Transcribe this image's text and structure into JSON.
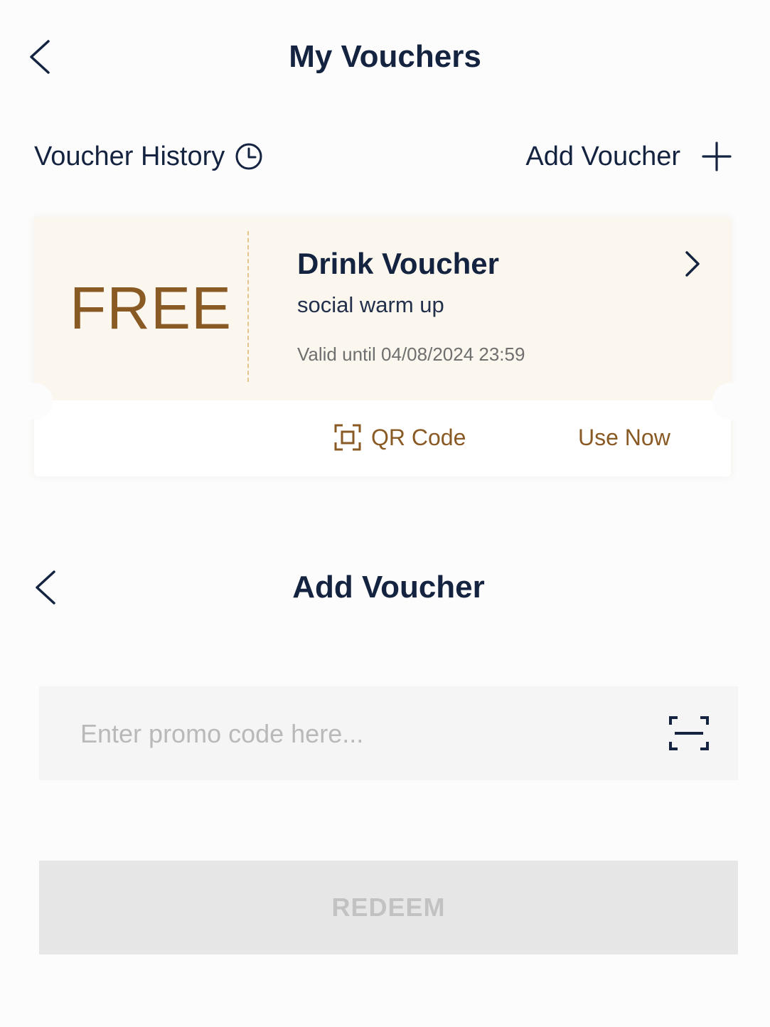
{
  "header": {
    "title": "My Vouchers",
    "back_icon": "chevron-left-icon"
  },
  "actions": {
    "history_label": "Voucher History",
    "history_icon": "clock-icon",
    "add_label": "Add Voucher",
    "add_icon": "plus-icon"
  },
  "voucher": {
    "badge": "FREE",
    "title": "Drink Voucher",
    "subtitle": "social warm up",
    "valid_until": "Valid until 04/08/2024 23:59",
    "qr_label": "QR Code",
    "qr_icon": "qr-scan-icon",
    "use_label": "Use Now",
    "detail_icon": "chevron-right-icon"
  },
  "add_voucher": {
    "title": "Add Voucher",
    "input_placeholder": "Enter promo code here...",
    "input_value": "",
    "scan_icon": "barcode-scan-icon",
    "redeem_label": "REDEEM"
  },
  "colors": {
    "navy": "#14233f",
    "gold": "#8a5a25",
    "card_bg": "#fbf7ef",
    "input_bg": "#f5f5f5",
    "disabled_bg": "#e6e6e6",
    "disabled_text": "#c2c2c2"
  }
}
